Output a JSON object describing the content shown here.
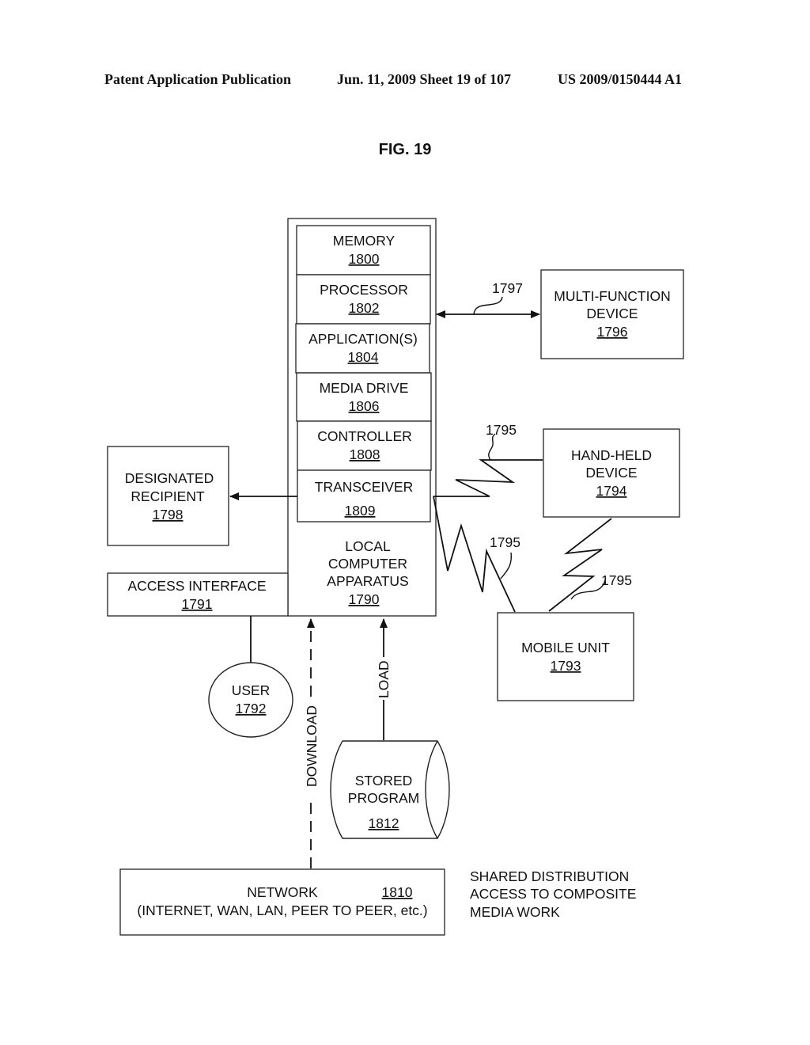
{
  "header": {
    "left": "Patent Application Publication",
    "middle": "Jun. 11, 2009  Sheet 19 of 107",
    "right": "US 2009/0150444 A1"
  },
  "figure_title": "FIG. 19",
  "apparatus": {
    "components": [
      {
        "label": "MEMORY",
        "number": "1800"
      },
      {
        "label": "PROCESSOR",
        "number": "1802"
      },
      {
        "label": "APPLICATION(S)",
        "number": "1804"
      },
      {
        "label": "MEDIA DRIVE",
        "number": "1806"
      },
      {
        "label": "CONTROLLER",
        "number": "1808"
      },
      {
        "label": "TRANSCEIVER",
        "number": "1809"
      }
    ],
    "label_lines": [
      "LOCAL",
      "COMPUTER",
      "APPARATUS"
    ],
    "number": "1790"
  },
  "multi_function_device": {
    "lines": [
      "MULTI-FUNCTION",
      "DEVICE"
    ],
    "number": "1796"
  },
  "hand_held_device": {
    "lines": [
      "HAND-HELD",
      "DEVICE"
    ],
    "number": "1794"
  },
  "mobile_unit": {
    "lines": [
      "MOBILE UNIT"
    ],
    "number": "1793"
  },
  "designated_recipient": {
    "lines": [
      "DESIGNATED",
      "RECIPIENT"
    ],
    "number": "1798"
  },
  "access_interface": {
    "lines": [
      "ACCESS INTERFACE"
    ],
    "number": "1791"
  },
  "user": {
    "label": "USER",
    "number": "1792"
  },
  "stored_program": {
    "lines": [
      "STORED",
      "PROGRAM"
    ],
    "number": "1812"
  },
  "network": {
    "label": "NETWORK",
    "number": "1810",
    "sublabel": "(INTERNET, WAN, LAN, PEER TO PEER, etc.)"
  },
  "link_labels": {
    "bidirectional": "1797",
    "wireless_handheld": "1795",
    "wireless_mobile": "1795",
    "wireless_handheld_mobile": "1795",
    "download": "DOWNLOAD",
    "load": "LOAD"
  },
  "caption": [
    "SHARED DISTRIBUTION",
    "ACCESS TO COMPOSITE",
    "MEDIA WORK"
  ]
}
